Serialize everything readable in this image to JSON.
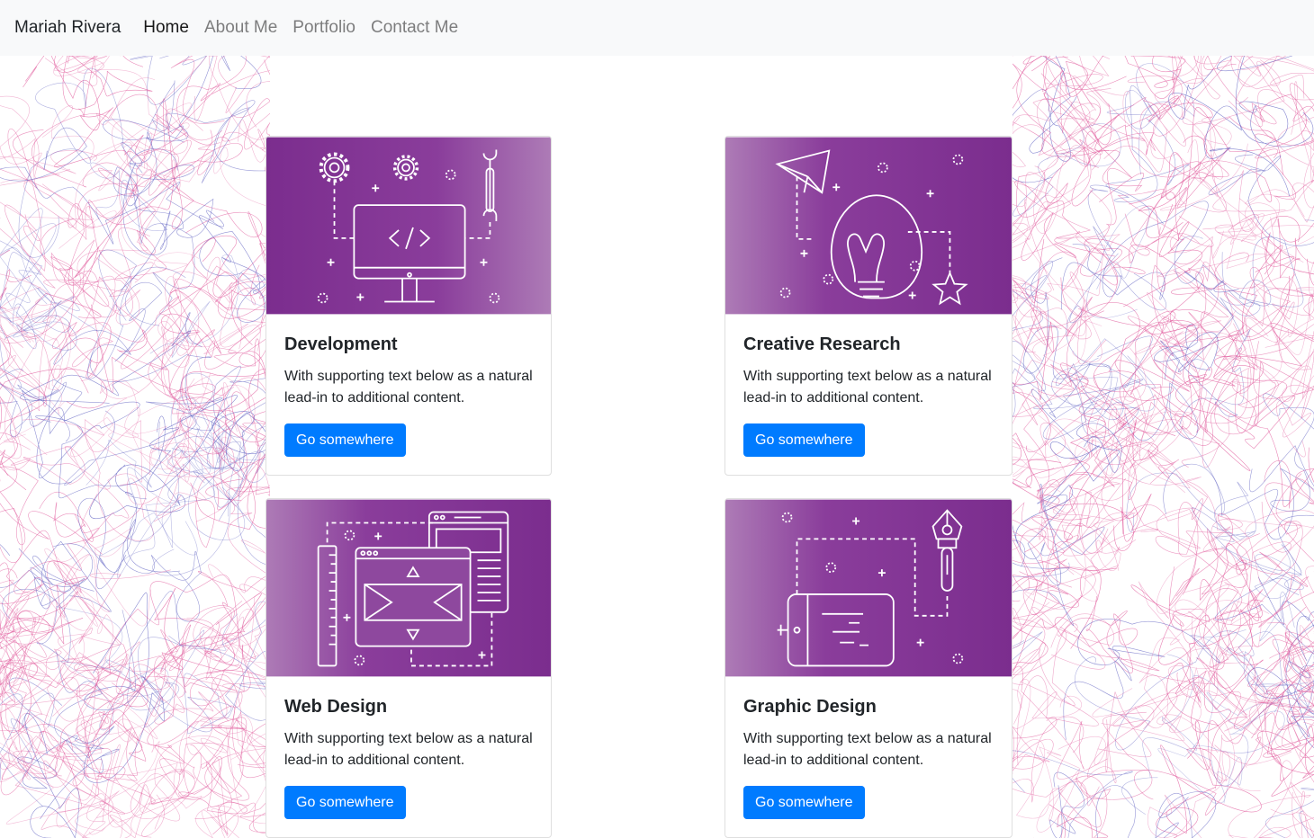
{
  "navbar": {
    "brand": "Mariah Rivera",
    "links": [
      {
        "label": "Home",
        "active": true
      },
      {
        "label": "About Me",
        "active": false
      },
      {
        "label": "Portfolio",
        "active": false
      },
      {
        "label": "Contact Me",
        "active": false
      }
    ]
  },
  "colors": {
    "accent": "#007bff",
    "card_gradient_dark": "#7b2d8e",
    "card_gradient_light": "#ad7bb6",
    "scribble_pink": "#e0569a",
    "scribble_blue": "#5a5cc0"
  },
  "cards": [
    {
      "title": "Development",
      "text": "With supporting text below as a natural lead-in to additional content.",
      "button": "Go somewhere",
      "icon": "monitor-code-icon"
    },
    {
      "title": "Creative Research",
      "text": "With supporting text below as a natural lead-in to additional content.",
      "button": "Go somewhere",
      "icon": "lightbulb-icon"
    },
    {
      "title": "Web Design",
      "text": "With supporting text below as a natural lead-in to additional content.",
      "button": "Go somewhere",
      "icon": "browser-window-icon"
    },
    {
      "title": "Graphic Design",
      "text": "With supporting text below as a natural lead-in to additional content.",
      "button": "Go somewhere",
      "icon": "drawing-tablet-icon"
    }
  ]
}
